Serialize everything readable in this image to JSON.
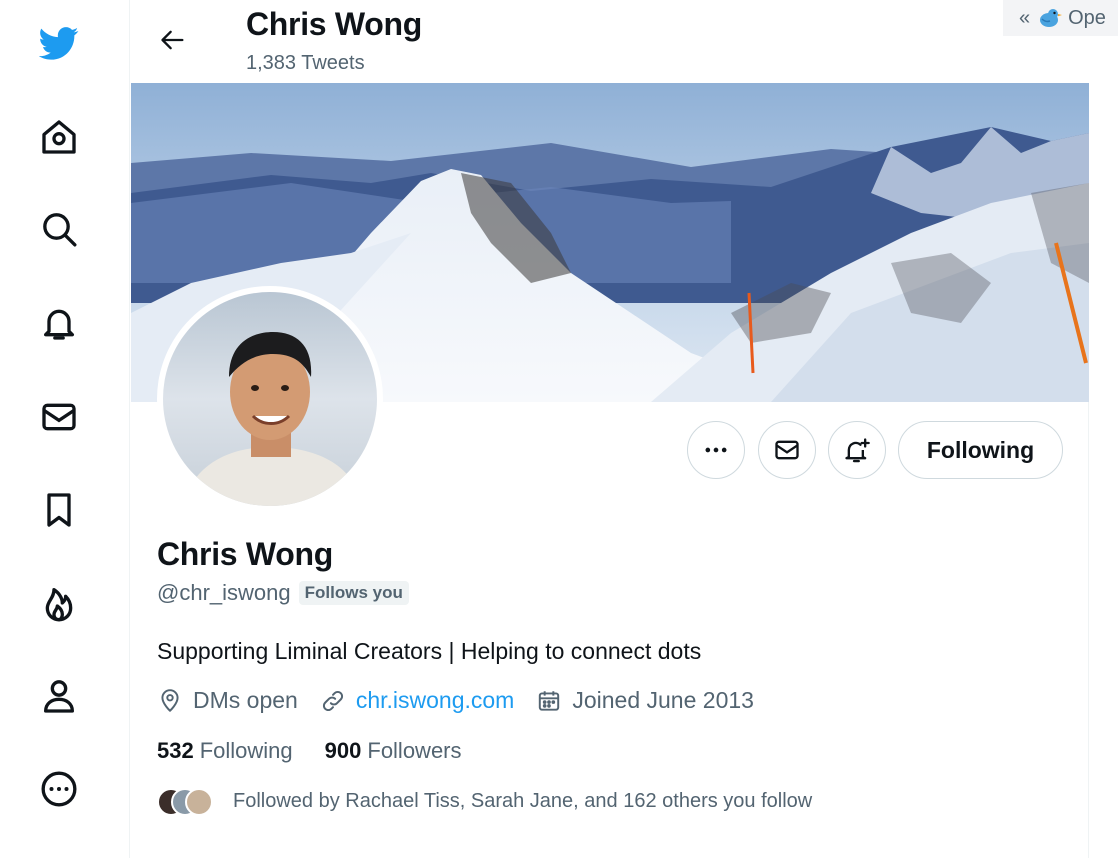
{
  "header": {
    "title": "Chris Wong",
    "tweet_count": "1,383 Tweets"
  },
  "extension_tab": {
    "chevron": "«",
    "label": "Ope"
  },
  "profile": {
    "display_name": "Chris Wong",
    "handle": "@chr_iswong",
    "follows_you_badge": "Follows you",
    "bio": "Supporting Liminal Creators | Helping to connect dots",
    "location": "DMs open",
    "website": "chr.iswong.com",
    "joined": "Joined June 2013",
    "following_count": "532",
    "following_label": "Following",
    "followers_count": "900",
    "followers_label": "Followers",
    "followed_by_text": "Followed by Rachael Tiss, Sarah Jane, and 162 others you follow"
  },
  "actions": {
    "following_button": "Following"
  },
  "nav": {
    "icons": [
      "twitter-logo-icon",
      "home-icon",
      "search-icon",
      "notifications-icon",
      "messages-icon",
      "bookmarks-icon",
      "trending-icon",
      "profile-icon",
      "more-icon"
    ]
  },
  "colors": {
    "brand": "#1d9bf0",
    "text_primary": "#0f1419",
    "text_secondary": "#536471",
    "border": "#cfd9de"
  }
}
